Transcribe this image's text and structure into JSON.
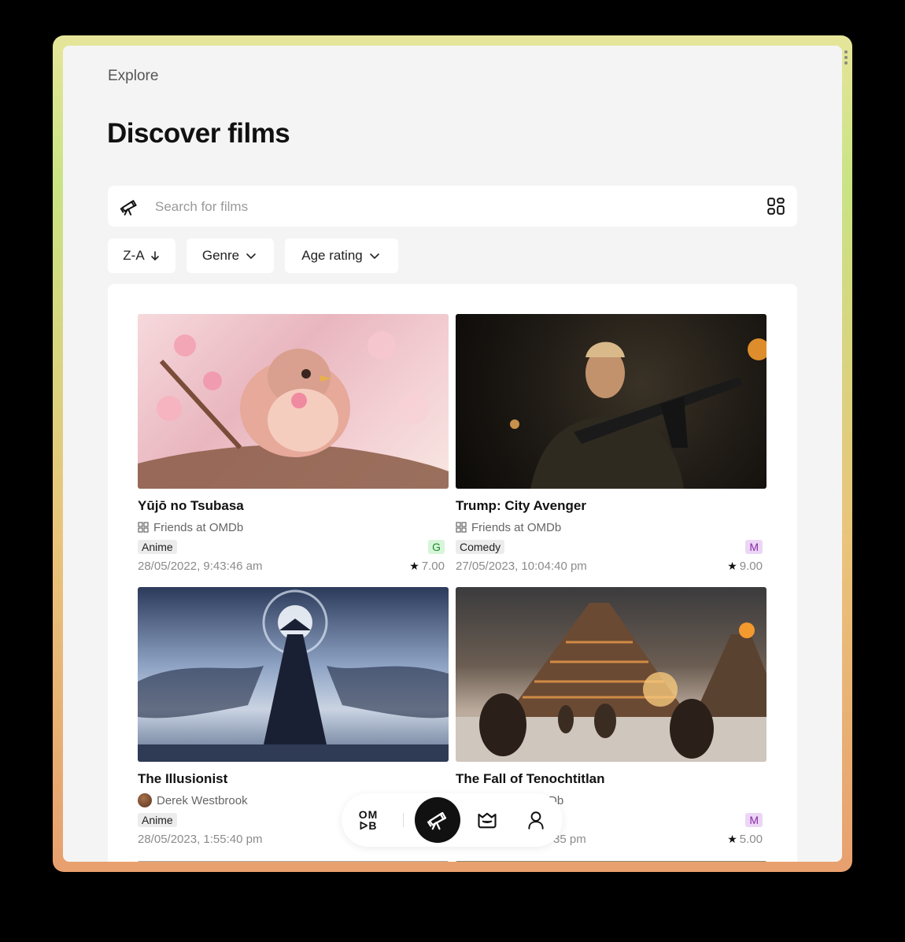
{
  "breadcrumb": "Explore",
  "page_title": "Discover films",
  "search": {
    "placeholder": "Search for films",
    "value": ""
  },
  "filters": {
    "sort_label": "Z-A",
    "genre_label": "Genre",
    "age_label": "Age rating"
  },
  "films": [
    {
      "title": "Yūjō no Tsubasa",
      "source": "Friends at OMDb",
      "genre": "Anime",
      "age": "G",
      "date": "28/05/2022, 9:43:46 am",
      "rating": "7.00"
    },
    {
      "title": "Trump: City Avenger",
      "source": "Friends at OMDb",
      "genre": "Comedy",
      "age": "M",
      "date": "27/05/2023, 10:04:40 pm",
      "rating": "9.00"
    },
    {
      "title": "The Illusionist",
      "source": "Derek Westbrook",
      "genre": "Anime",
      "age": "",
      "date": "28/05/2023, 1:55:40 pm",
      "rating": ""
    },
    {
      "title": "The Fall of Tenochtitlan",
      "source": "Db",
      "genre": "",
      "age": "M",
      "date": "35 pm",
      "rating": "5.00"
    }
  ],
  "dock": {
    "omdb_top": "OM",
    "omdb_bottom": "ᐅB"
  },
  "colors": {
    "age_g_bg": "#d6f5d9",
    "age_g_fg": "#1f8a2c",
    "age_m_bg": "#ecd6f5",
    "age_m_fg": "#8a2aa8",
    "frame_top": "#e6e59a",
    "frame_bottom": "#e8a06e"
  }
}
